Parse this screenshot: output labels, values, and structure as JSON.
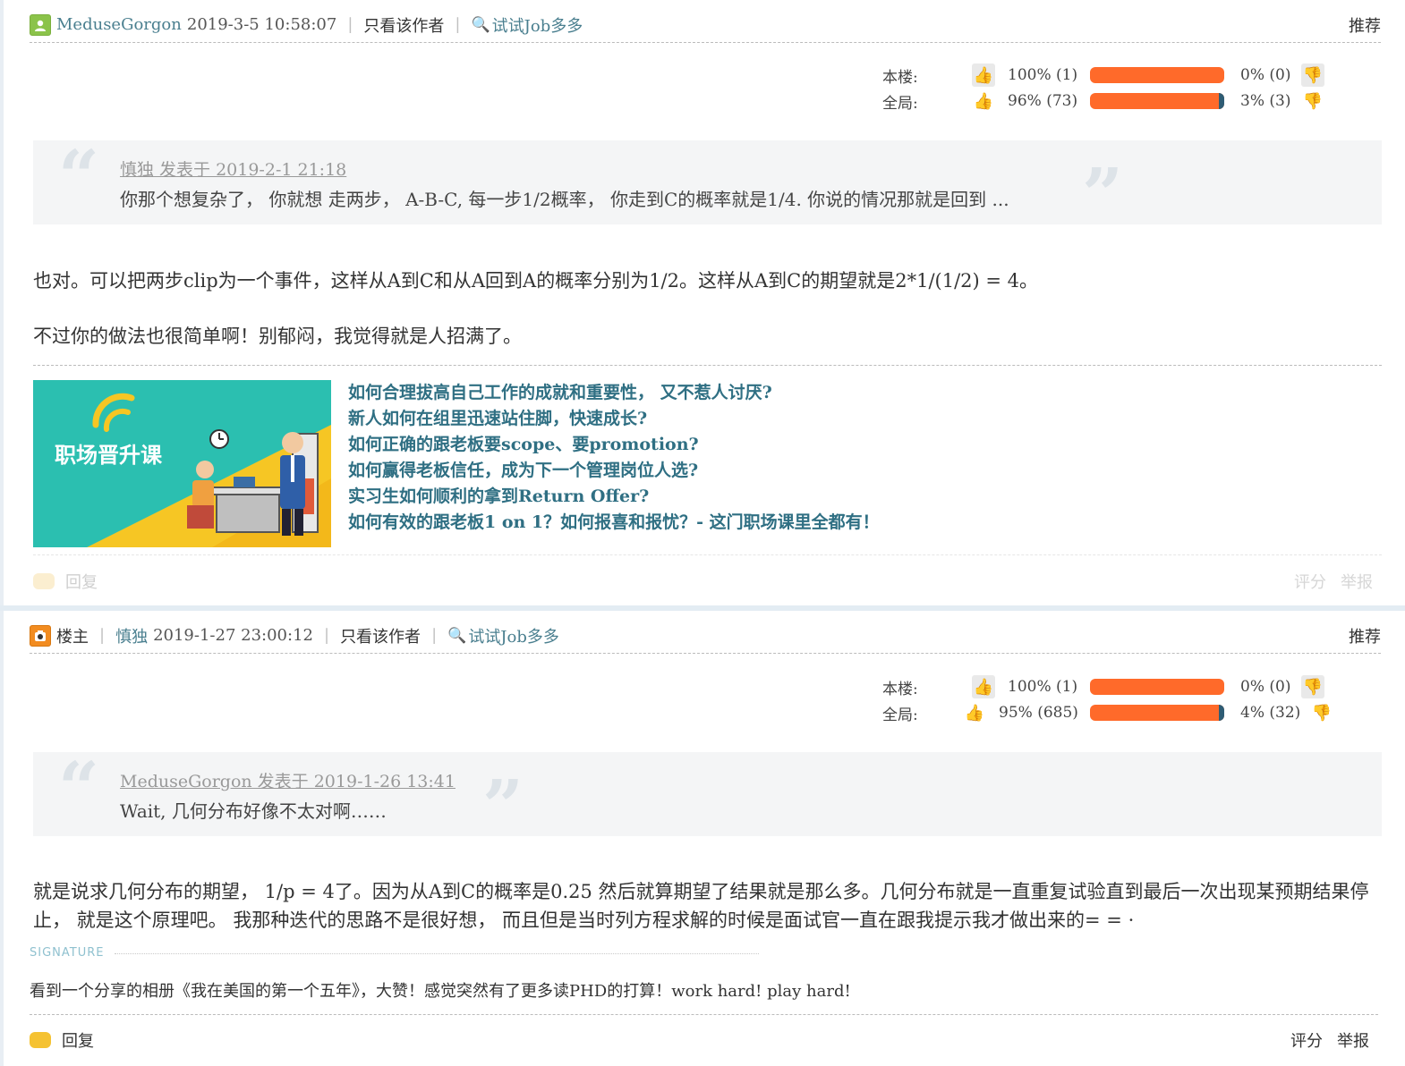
{
  "post1": {
    "author": "MeduseGorgon",
    "time": "2019-3-5 10:58:07",
    "only_author": "只看该作者",
    "try_job": "试试Job多多",
    "recommend": "推荐",
    "votes": {
      "floor_label": "本楼:",
      "floor_up": "100% (1)",
      "floor_down": "0% (0)",
      "floor_up_fraction": 1.0,
      "global_label": "全局:",
      "global_up": "96% (73)",
      "global_down": "3% (3)",
      "global_up_fraction": 0.96
    },
    "quote_meta": "慎独 发表于 2019-2-1 21:18",
    "quote_text": "你那个想复杂了， 你就想 走两步， A-B-C, 每一步1/2概率， 你走到C的概率就是1/4. 你说的情况那就是回到 ...",
    "paragraph1": "也对。可以把两步clip为一个事件，这样从A到C和从A回到A的概率分别为1/2。这样从A到C的期望就是2*1/(1/2) = 4。",
    "paragraph2": "不过你的做法也很简单啊！别郁闷，我觉得就是人招满了。",
    "ad_banner_text": "职场晋升课",
    "ad_links": [
      "如何合理拔高自己工作的成就和重要性， 又不惹人讨厌?",
      "新人如何在组里迅速站住脚，快速成长?",
      "如何正确的跟老板要scope、要promotion?",
      "如何赢得老板信任，成为下一个管理岗位人选?",
      "实习生如何顺利的拿到Return Offer?",
      "如何有效的跟老板1 on 1？如何报喜和报忧？- 这门职场课里全都有！"
    ],
    "reply": "回复",
    "rate": "评分",
    "report": "举报"
  },
  "post2": {
    "louzhu": "楼主",
    "author": "慎独",
    "time": "2019-1-27 23:00:12",
    "only_author": "只看该作者",
    "try_job": "试试Job多多",
    "recommend": "推荐",
    "votes": {
      "floor_label": "本楼:",
      "floor_up": "100% (1)",
      "floor_down": "0% (0)",
      "floor_up_fraction": 1.0,
      "global_label": "全局:",
      "global_up": "95% (685)",
      "global_down": "4% (32)",
      "global_up_fraction": 0.96
    },
    "quote_meta": "MeduseGorgon 发表于 2019-1-26 13:41",
    "quote_text": "Wait, 几何分布好像不太对啊……",
    "paragraph_line1": "就是说求几何分布的期望， 1/p = 4了。因为从A到C的概率是0.25 然后就算期望了结果就是那么多。几何分布就是一直重复试验直到最后一次出现某预期结果停",
    "paragraph_line2": "止， 就是这个原理吧。 我那种迭代的思路不是很好想， 而且但是当时列方程求解的时候是面试官一直在跟我提示我才做出来的= = ·",
    "signature_label": "SIGNATURE",
    "signature_text": "看到一个分享的相册《我在美国的第一个五年》，大赞！感觉突然有了更多读PHD的打算！work hard! play hard!",
    "reply": "回复",
    "rate": "评分",
    "report": "举报"
  },
  "colors": {
    "bar_up": "#ff6a2a",
    "bar_down": "#2e5c74",
    "link": "#4a7f8f",
    "ad_link": "#2f6f83",
    "thumb": "#f5a623"
  },
  "icons": {
    "avatar1": "user-avatar-icon",
    "avatar2": "owner-avatar-icon",
    "search": "magnifier-icon",
    "thumb_up": "thumbs-up-icon",
    "thumb_down": "thumbs-down-icon",
    "reply": "speech-bubble-icon",
    "quote_open": "quote-open-icon",
    "quote_close": "quote-close-icon"
  }
}
